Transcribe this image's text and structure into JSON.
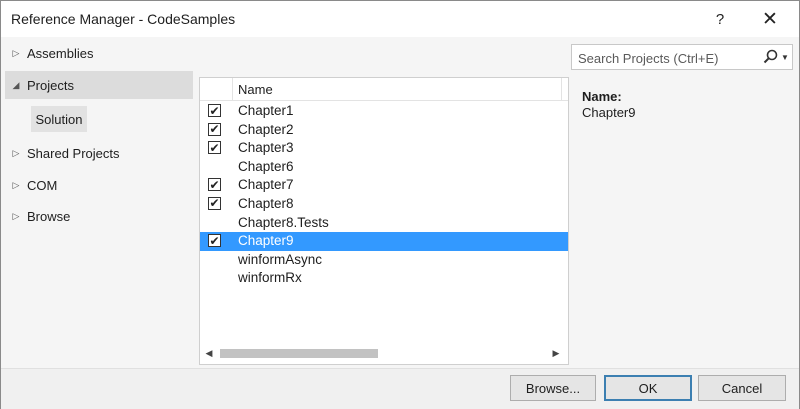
{
  "window": {
    "title": "Reference Manager - CodeSamples",
    "help_label": "?",
    "close_label": "✕"
  },
  "nav": {
    "items": [
      {
        "label": "Assemblies",
        "arrow": "▷",
        "selected": false
      },
      {
        "label": "Projects",
        "arrow": "◢",
        "selected": true
      },
      {
        "label": "Shared Projects",
        "arrow": "▷",
        "selected": false
      },
      {
        "label": "COM",
        "arrow": "▷",
        "selected": false
      },
      {
        "label": "Browse",
        "arrow": "▷",
        "selected": false
      }
    ],
    "sub_item": {
      "label": "Solution"
    }
  },
  "list": {
    "column_header": "Name",
    "rows": [
      {
        "name": "Chapter1",
        "checked": true
      },
      {
        "name": "Chapter2",
        "checked": true
      },
      {
        "name": "Chapter3",
        "checked": true
      },
      {
        "name": "Chapter6",
        "checked": false
      },
      {
        "name": "Chapter7",
        "checked": true
      },
      {
        "name": "Chapter8",
        "checked": true
      },
      {
        "name": "Chapter8.Tests",
        "checked": false
      },
      {
        "name": "Chapter9",
        "checked": true,
        "selected": true
      },
      {
        "name": "winformAsync",
        "checked": false
      },
      {
        "name": "winformRx",
        "checked": false
      }
    ],
    "scroll_left": "◀",
    "scroll_right": "▶"
  },
  "search": {
    "placeholder": "Search Projects (Ctrl+E)",
    "value": ""
  },
  "details": {
    "name_label": "Name:",
    "name_value": "Chapter9"
  },
  "footer": {
    "browse_label": "Browse...",
    "ok_label": "OK",
    "cancel_label": "Cancel"
  },
  "colors": {
    "selection": "#3399ff",
    "default_button_border": "#3c7fb1"
  }
}
